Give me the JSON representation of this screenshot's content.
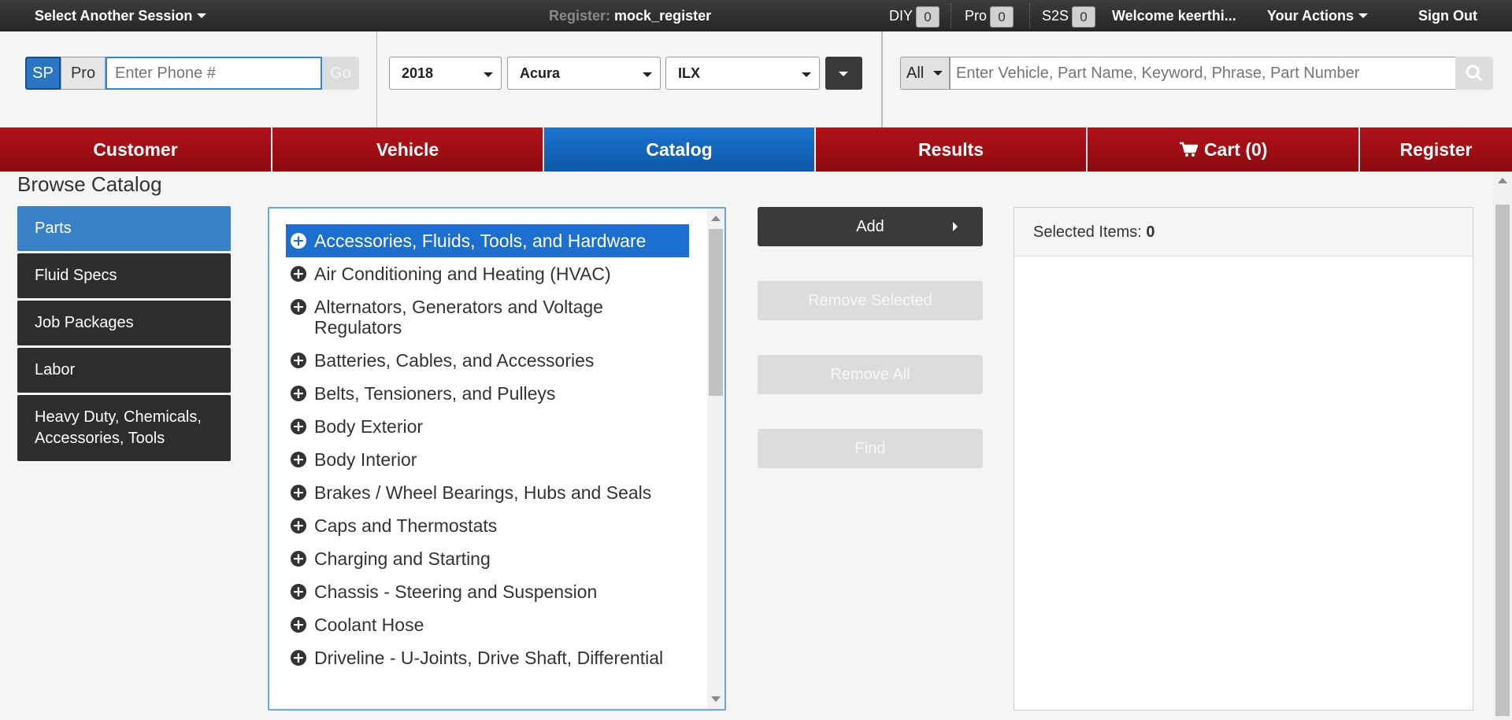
{
  "topbar": {
    "session_label": "Select Another Session",
    "register_label": "Register:",
    "register_value": "mock_register",
    "counters": [
      {
        "label": "DIY",
        "value": "0"
      },
      {
        "label": "Pro",
        "value": "0"
      },
      {
        "label": "S2S",
        "value": "0"
      }
    ],
    "welcome": "Welcome keerthi...",
    "actions_label": "Your Actions",
    "signout_label": "Sign Out"
  },
  "header": {
    "sp_label": "SP",
    "pro_label": "Pro",
    "phone_placeholder": "Enter Phone #",
    "go_label": "Go",
    "year": "2018",
    "make": "Acura",
    "model": "ILX",
    "search_scope": "All",
    "search_placeholder": "Enter Vehicle, Part Name, Keyword, Phrase, Part Number"
  },
  "nav": {
    "tabs": [
      {
        "label": "Customer",
        "active": false
      },
      {
        "label": "Vehicle",
        "active": false
      },
      {
        "label": "Catalog",
        "active": true
      },
      {
        "label": "Results",
        "active": false
      },
      {
        "label": "Cart (0)",
        "active": false
      },
      {
        "label": "Register",
        "active": false
      }
    ]
  },
  "main": {
    "title": "Browse Catalog",
    "sidebar": [
      {
        "label": "Parts",
        "active": true
      },
      {
        "label": "Fluid Specs",
        "active": false
      },
      {
        "label": "Job Packages",
        "active": false
      },
      {
        "label": "Labor",
        "active": false
      },
      {
        "label": "Heavy Duty, Chemicals, Accessories, Tools",
        "active": false
      }
    ],
    "categories": [
      "Accessories, Fluids, Tools, and Hardware",
      "Air Conditioning and Heating (HVAC)",
      "Alternators, Generators and Voltage Regulators",
      "Batteries, Cables, and Accessories",
      "Belts, Tensioners, and Pulleys",
      "Body Exterior",
      "Body Interior",
      "Brakes / Wheel Bearings, Hubs and Seals",
      "Caps and Thermostats",
      "Charging and Starting",
      "Chassis - Steering and Suspension",
      "Coolant Hose",
      "Driveline - U-Joints, Drive Shaft, Differential"
    ],
    "selected_category_index": 0,
    "actions": {
      "add": "Add",
      "remove_selected": "Remove Selected",
      "remove_all": "Remove All",
      "find": "Find"
    },
    "selected_items_label": "Selected Items:",
    "selected_items_count": "0"
  },
  "colors": {
    "nav_red": "#a00e15",
    "nav_active_blue": "#1565c0",
    "selected_blue": "#1c6fcf",
    "sidebar_dark": "#2d2d2d"
  }
}
